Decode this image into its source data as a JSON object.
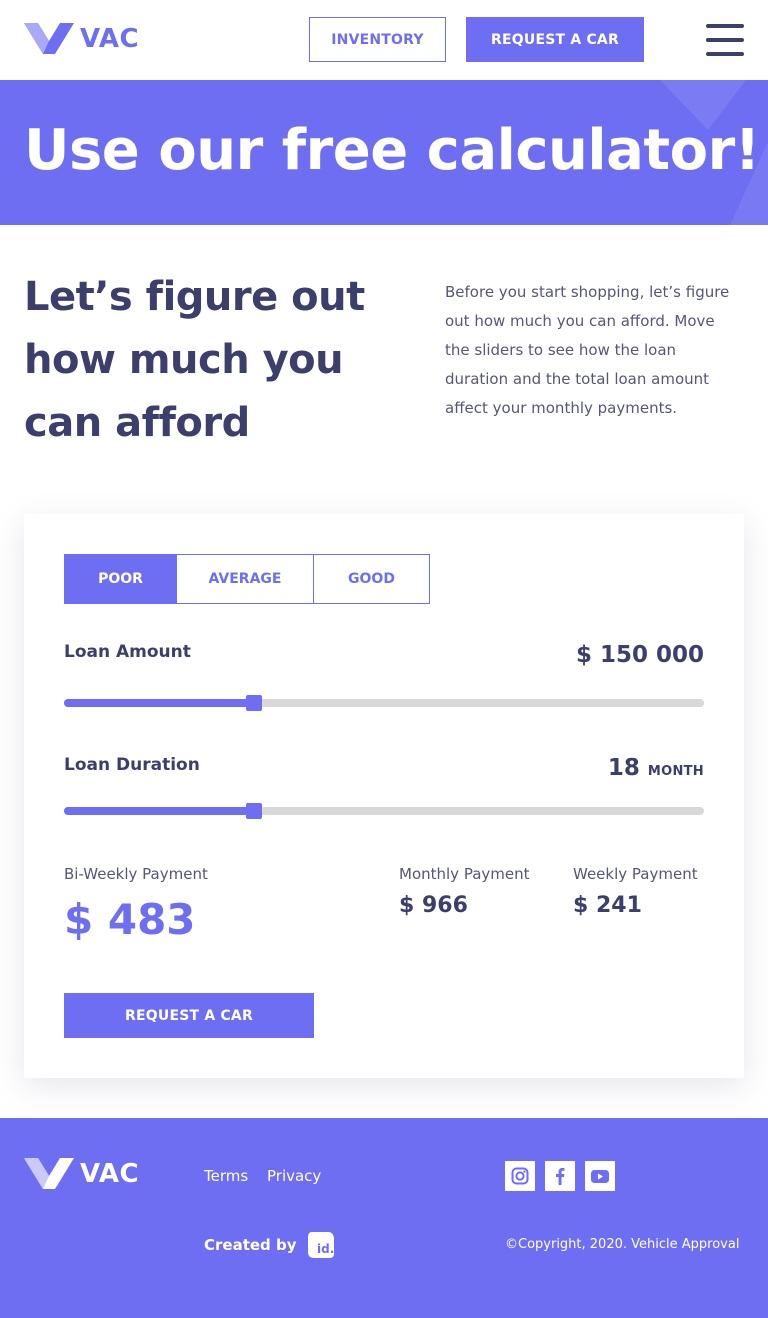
{
  "header": {
    "logo_text": "VAC",
    "inventory_label": "INVENTORY",
    "request_label": "REQUEST A CAR",
    "menu_icon": "hamburger-menu-icon"
  },
  "hero": {
    "title": "Use our free calculator!"
  },
  "intro": {
    "heading": "Let’s figure out how much you can afford",
    "text": "Before you start shopping, let’s figure out how much you can afford. Move the sliders to see how the loan duration and the total loan amount affect your monthly payments."
  },
  "calculator": {
    "credit_tabs": {
      "poor": "POOR",
      "average": "AVERAGE",
      "good": "GOOD",
      "selected": "POOR"
    },
    "loan_amount": {
      "label": "Loan Amount",
      "value": "$ 150 000",
      "slider_fraction": 0.297
    },
    "loan_duration": {
      "label": "Loan Duration",
      "value": "18",
      "unit": "MONTH",
      "slider_fraction": 0.297
    },
    "payments": {
      "biweekly_label": "Bi-Weekly Payment",
      "biweekly_value": "$ 483",
      "monthly_label": "Monthly Payment",
      "monthly_value": "$ 966",
      "weekly_label": "Weekly Payment",
      "weekly_value": "$ 241"
    },
    "request_label": "REQUEST A CAR"
  },
  "footer": {
    "logo_text": "VAC",
    "links": {
      "terms": "Terms",
      "privacy": "Privacy"
    },
    "social_icons": [
      "instagram-icon",
      "facebook-icon",
      "youtube-icon"
    ],
    "created_by": "Created by",
    "copyright": "©Copyright, 2020. Vehicle Approval"
  },
  "colors": {
    "accent": "#6e6ef2",
    "text_dark": "#3c3e6b",
    "track": "#d8d8d8",
    "white": "#ffffff"
  }
}
